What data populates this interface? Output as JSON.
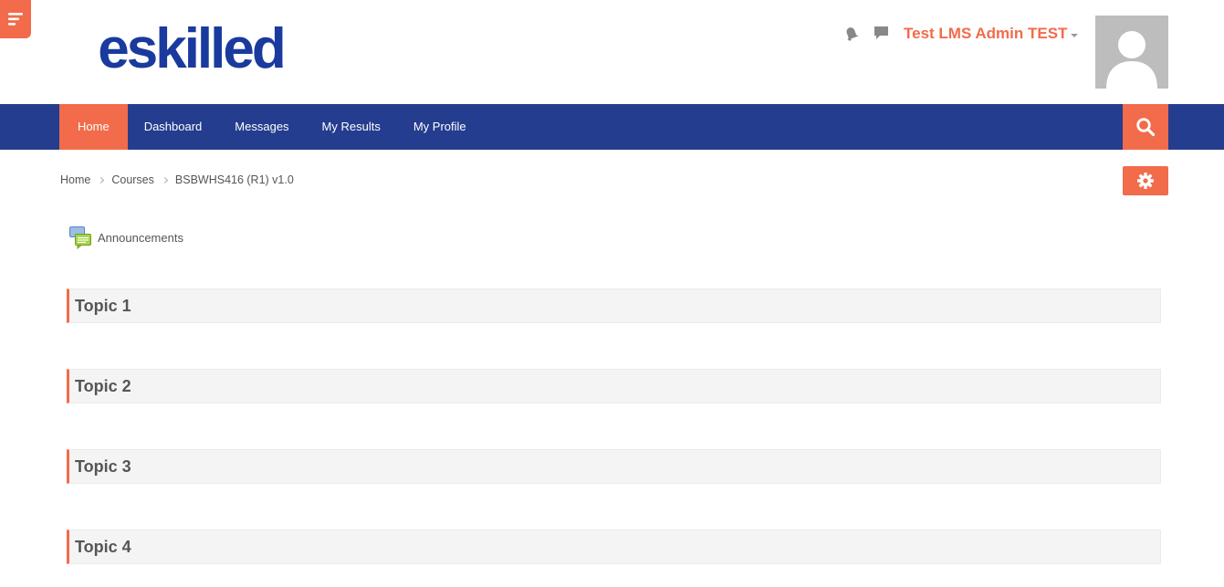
{
  "header": {
    "logo_text": "eskilled",
    "username": "Test LMS Admin TEST"
  },
  "nav": {
    "items": [
      {
        "label": "Home",
        "active": true
      },
      {
        "label": "Dashboard",
        "active": false
      },
      {
        "label": "Messages",
        "active": false
      },
      {
        "label": "My Results",
        "active": false
      },
      {
        "label": "My Profile",
        "active": false
      }
    ]
  },
  "breadcrumb": {
    "items": [
      "Home",
      "Courses",
      "BSBWHS416 (R1) v1.0"
    ]
  },
  "announcements": {
    "label": "Announcements"
  },
  "topics": [
    {
      "title": "Topic 1"
    },
    {
      "title": "Topic 2"
    },
    {
      "title": "Topic 3"
    },
    {
      "title": "Topic 4"
    }
  ],
  "icons": {
    "drawer": "hamburger-icon",
    "notifications": "bell-icon",
    "messages": "chat-icon",
    "search": "search-icon",
    "settings": "gear-icon",
    "announcements": "forum-icon"
  },
  "colors": {
    "accent": "#f26b4a",
    "navbar": "#243d8f",
    "logo": "#1a3a9e"
  }
}
